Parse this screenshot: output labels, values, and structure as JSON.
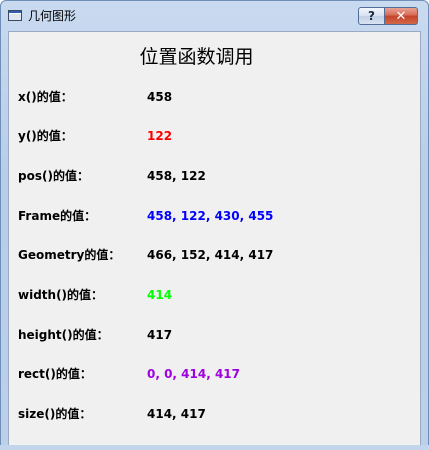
{
  "window": {
    "title": "几何图形",
    "help_glyph": "?",
    "close_glyph": "✕"
  },
  "heading": "位置函数调用",
  "rows": [
    {
      "label": "x()的值：",
      "value": "458",
      "color": "#000000"
    },
    {
      "label": "y()的值：",
      "value": "122",
      "color": "#ff0000"
    },
    {
      "label": "pos()的值：",
      "value": "458, 122",
      "color": "#000000"
    },
    {
      "label": "Frame的值：",
      "value": "458, 122, 430, 455",
      "color": "#0000ff"
    },
    {
      "label": "Geometry的值：",
      "value": "466, 152, 414, 417",
      "color": "#000000"
    },
    {
      "label": "width()的值：",
      "value": "414",
      "color": "#00ff00"
    },
    {
      "label": "height()的值：",
      "value": "417",
      "color": "#000000"
    },
    {
      "label": "rect()的值：",
      "value": "0, 0, 414, 417",
      "color": "#a000e0"
    },
    {
      "label": "size()的值：",
      "value": "414, 417",
      "color": "#000000"
    }
  ]
}
